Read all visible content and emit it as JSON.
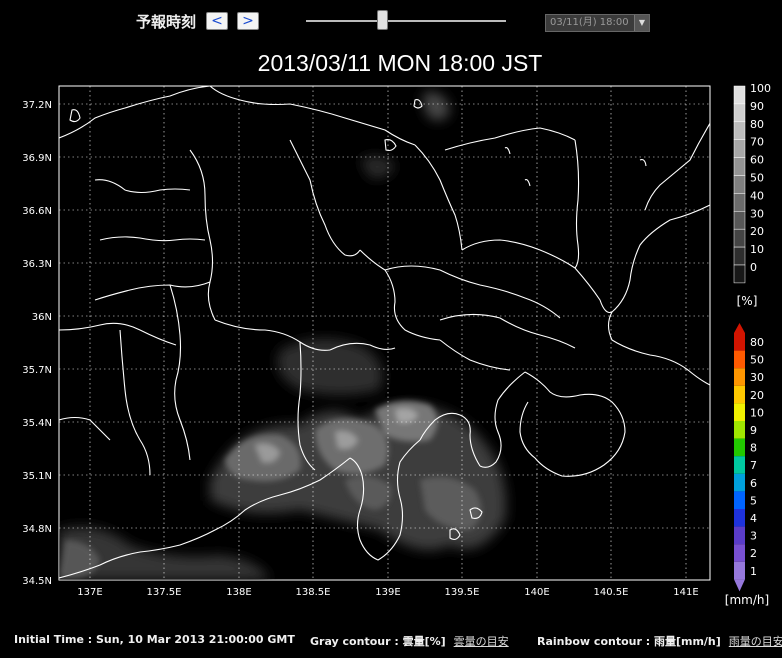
{
  "controls": {
    "forecast_label": "予報時刻",
    "prev_label": "<",
    "next_label": ">",
    "selected_time": "03/11(月) 18:00",
    "slider_value": 0.38
  },
  "title": "2013/03/11 MON 18:00 JST",
  "axes": {
    "lat_ticks": [
      "37.2N",
      "36.9N",
      "36.6N",
      "36.3N",
      "36N",
      "35.7N",
      "35.4N",
      "35.1N",
      "34.8N",
      "34.5N"
    ],
    "lon_ticks": [
      "137E",
      "137.5E",
      "138E",
      "138.5E",
      "139E",
      "139.5E",
      "140E",
      "140.5E",
      "141E"
    ]
  },
  "legends": {
    "cloud": {
      "unit": "[%]",
      "ticks": [
        "100",
        "90",
        "80",
        "70",
        "60",
        "50",
        "40",
        "30",
        "20",
        "10",
        "0"
      ],
      "colors": [
        "#e0e0e0",
        "#cfcfcf",
        "#bcbcbc",
        "#a8a8a8",
        "#949494",
        "#808080",
        "#6c6c6c",
        "#585858",
        "#444444",
        "#2e2e2e",
        "#181818"
      ]
    },
    "rain": {
      "unit": "[mm/h]",
      "ticks": [
        "80",
        "50",
        "30",
        "20",
        "10",
        "9",
        "8",
        "7",
        "6",
        "5",
        "4",
        "3",
        "2",
        "1"
      ],
      "colors": [
        "#d21400",
        "#ff5a00",
        "#ff9600",
        "#ffc800",
        "#f0f000",
        "#a0e600",
        "#22c800",
        "#00c8a0",
        "#00a0dc",
        "#0064ff",
        "#1e32dc",
        "#5a3cc8",
        "#7850d2",
        "#9678dc"
      ]
    }
  },
  "footer": {
    "initial_time": "Initial Time : Sun, 10 Mar 2013 21:00:00 GMT",
    "gray_contour": "Gray contour : 雲量[%]",
    "gray_link": "雲量の目安",
    "rainbow_contour": "Rainbow contour : 雨量[mm/h]",
    "rainbow_link": "雨量の目安"
  }
}
